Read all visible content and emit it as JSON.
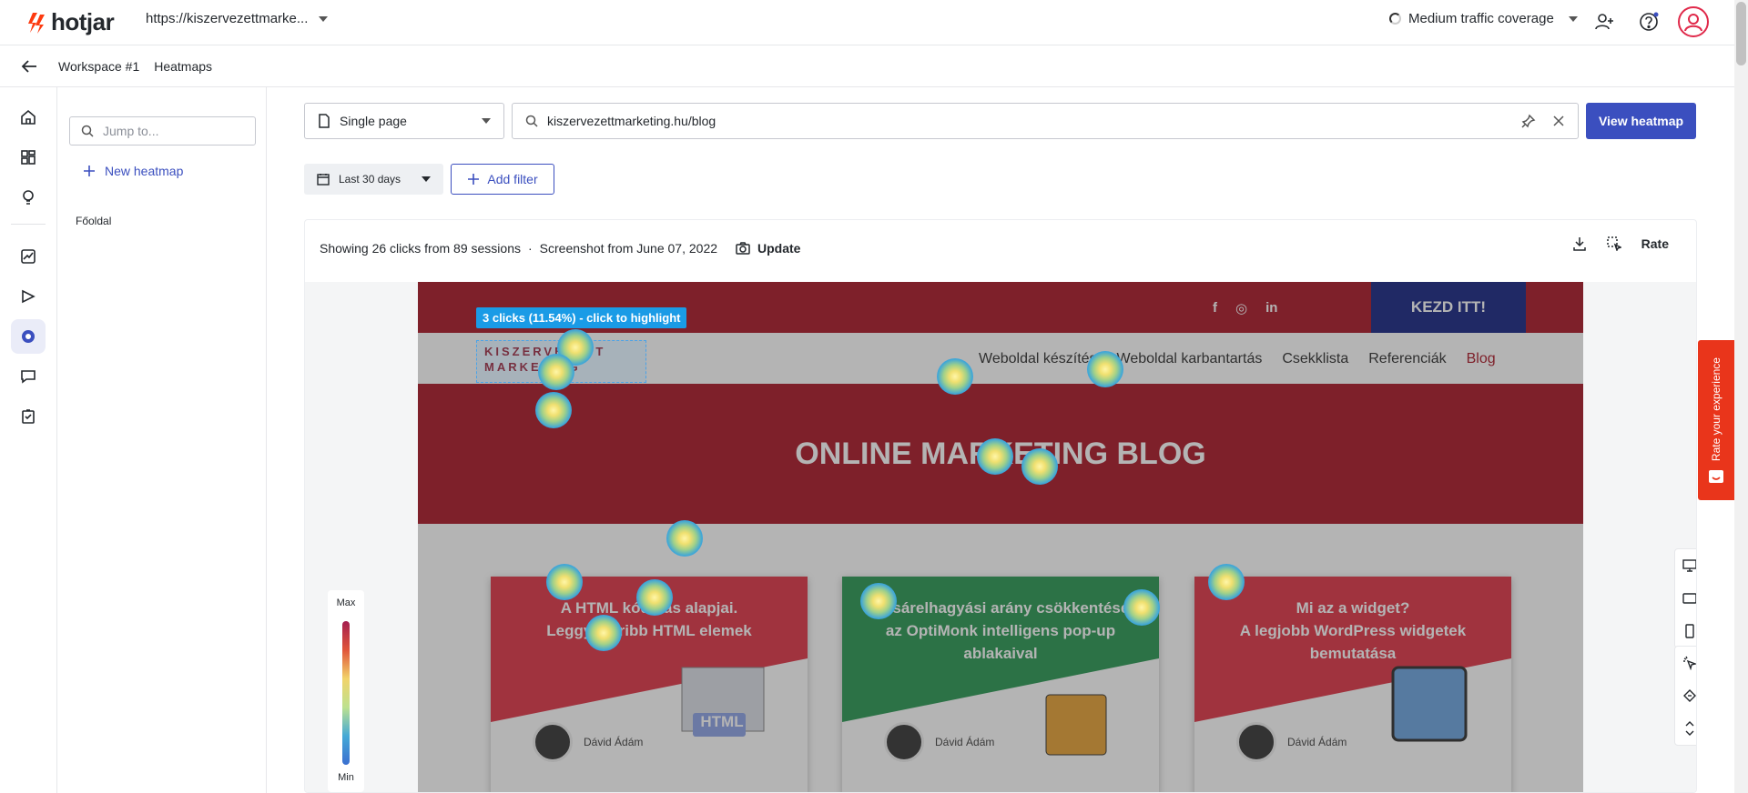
{
  "app": {
    "name": "hotjar",
    "site_url": "https://kiszervezettmarke...",
    "traffic_coverage": "Medium traffic coverage"
  },
  "breadcrumb": {
    "workspace": "Workspace #1",
    "section": "Heatmaps"
  },
  "sidebar": {
    "search_placeholder": "Jump to...",
    "new_heatmap_label": "New heatmap",
    "folder_label": "Főoldal"
  },
  "controls": {
    "page_type": "Single page",
    "url_value": "kiszervezettmarketing.hu/blog",
    "view_button": "View heatmap",
    "date_range": "Last 30 days",
    "add_filter": "Add filter"
  },
  "stats": {
    "summary": "Showing 26 clicks from 89 sessions",
    "dot": "·",
    "screenshot": "Screenshot from June 07, 2022",
    "update_label": "Update",
    "rate_label": "Rate"
  },
  "heatmap": {
    "tooltip": "3 clicks (11.54%) - click to highlight",
    "legend_max": "Max",
    "legend_min": "Min"
  },
  "site": {
    "cta": "KEZD ITT!",
    "social": [
      "f",
      "◎",
      "in"
    ],
    "logo_line1": "KISZERVEZETT",
    "logo_line2": "MARKETING",
    "menu": [
      "Weboldal készítés",
      "Weboldal karbantartás",
      "Csekklista",
      "Referenciák",
      "Blog"
    ],
    "hero_title": "ONLINE MARKETING BLOG",
    "posts": [
      {
        "title_line1": "A HTML kódolás alapjai.",
        "title_line2": "Leggyakoribb HTML elemek",
        "title_line3": "",
        "author": "Dávid Ádám",
        "image_text": "HTML"
      },
      {
        "title_line1": "Kosárelhagyási arány csökkentése",
        "title_line2": "az OptiMonk intelligens pop-up",
        "title_line3": "ablakaival",
        "author": "Dávid Ádám"
      },
      {
        "title_line1": "Mi az a widget?",
        "title_line2": "A legjobb WordPress widgetek",
        "title_line3": "bemutatása",
        "author": "Dávid Ádám"
      }
    ]
  },
  "feedback": {
    "label": "Rate your experience"
  },
  "colors": {
    "brand_red": "#ad1d2c",
    "cta_blue": "#1c2a86",
    "primary": "#3b4fbf",
    "feedback": "#e9351b",
    "post_green": "#2f9a57"
  }
}
